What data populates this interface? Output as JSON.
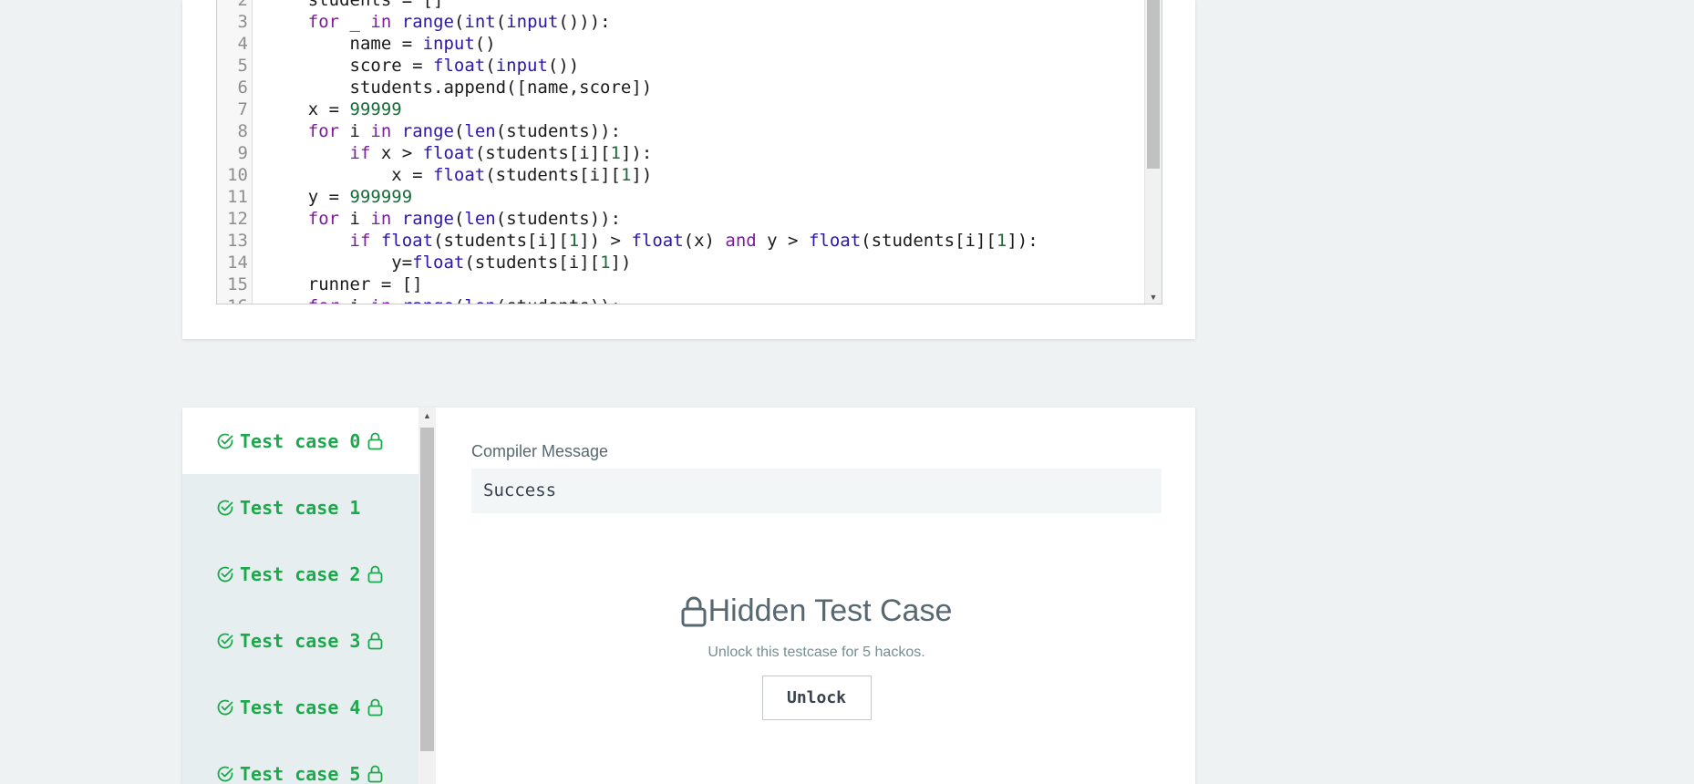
{
  "editor": {
    "lines": [
      {
        "num": "2",
        "tokens": [
          [
            "",
            "    students = []"
          ]
        ]
      },
      {
        "num": "3",
        "tokens": [
          [
            "",
            "    "
          ],
          [
            "kw",
            "for"
          ],
          [
            "",
            " _ "
          ],
          [
            "kw",
            "in"
          ],
          [
            "",
            " "
          ],
          [
            "bi",
            "range"
          ],
          [
            "",
            "("
          ],
          [
            "bi",
            "int"
          ],
          [
            "",
            "("
          ],
          [
            "bi",
            "input"
          ],
          [
            "",
            "())):"
          ]
        ]
      },
      {
        "num": "4",
        "tokens": [
          [
            "",
            "        name = "
          ],
          [
            "bi",
            "input"
          ],
          [
            "",
            "()"
          ]
        ]
      },
      {
        "num": "5",
        "tokens": [
          [
            "",
            "        score = "
          ],
          [
            "bi",
            "float"
          ],
          [
            "",
            "("
          ],
          [
            "bi",
            "input"
          ],
          [
            "",
            "())"
          ]
        ]
      },
      {
        "num": "6",
        "tokens": [
          [
            "",
            "        students.append([name,score])"
          ]
        ]
      },
      {
        "num": "7",
        "tokens": [
          [
            "",
            "    x = "
          ],
          [
            "num",
            "99999"
          ]
        ]
      },
      {
        "num": "8",
        "tokens": [
          [
            "",
            "    "
          ],
          [
            "kw",
            "for"
          ],
          [
            "",
            " i "
          ],
          [
            "kw",
            "in"
          ],
          [
            "",
            " "
          ],
          [
            "bi",
            "range"
          ],
          [
            "",
            "("
          ],
          [
            "bi",
            "len"
          ],
          [
            "",
            "(students)):"
          ]
        ]
      },
      {
        "num": "9",
        "tokens": [
          [
            "",
            "        "
          ],
          [
            "kw",
            "if"
          ],
          [
            "",
            " x > "
          ],
          [
            "bi",
            "float"
          ],
          [
            "",
            "(students[i]["
          ],
          [
            "num",
            "1"
          ],
          [
            "",
            "]):"
          ]
        ]
      },
      {
        "num": "10",
        "tokens": [
          [
            "",
            "            x = "
          ],
          [
            "bi",
            "float"
          ],
          [
            "",
            "(students[i]["
          ],
          [
            "num",
            "1"
          ],
          [
            "",
            "])"
          ]
        ]
      },
      {
        "num": "11",
        "tokens": [
          [
            "",
            "    y = "
          ],
          [
            "num",
            "999999"
          ]
        ]
      },
      {
        "num": "12",
        "tokens": [
          [
            "",
            "    "
          ],
          [
            "kw",
            "for"
          ],
          [
            "",
            " i "
          ],
          [
            "kw",
            "in"
          ],
          [
            "",
            " "
          ],
          [
            "bi",
            "range"
          ],
          [
            "",
            "("
          ],
          [
            "bi",
            "len"
          ],
          [
            "",
            "(students)):"
          ]
        ]
      },
      {
        "num": "13",
        "tokens": [
          [
            "",
            "        "
          ],
          [
            "kw",
            "if"
          ],
          [
            "",
            " "
          ],
          [
            "bi",
            "float"
          ],
          [
            "",
            "(students[i]["
          ],
          [
            "num",
            "1"
          ],
          [
            "",
            "]) > "
          ],
          [
            "bi",
            "float"
          ],
          [
            "",
            "(x) "
          ],
          [
            "kw",
            "and"
          ],
          [
            "",
            " y > "
          ],
          [
            "bi",
            "float"
          ],
          [
            "",
            "(students[i]["
          ],
          [
            "num",
            "1"
          ],
          [
            "",
            "]):"
          ]
        ]
      },
      {
        "num": "14",
        "tokens": [
          [
            "",
            "            y="
          ],
          [
            "bi",
            "float"
          ],
          [
            "",
            "(students[i]["
          ],
          [
            "num",
            "1"
          ],
          [
            "",
            "])"
          ]
        ]
      },
      {
        "num": "15",
        "tokens": [
          [
            "",
            "    runner = []"
          ]
        ]
      },
      {
        "num": "16",
        "tokens": [
          [
            "",
            "    "
          ],
          [
            "kw",
            "for"
          ],
          [
            "",
            " i "
          ],
          [
            "kw",
            "in"
          ],
          [
            "",
            " "
          ],
          [
            "bi",
            "range"
          ],
          [
            "",
            "("
          ],
          [
            "bi",
            "len"
          ],
          [
            "",
            "(students)):"
          ]
        ]
      }
    ],
    "scroll_arrow": "▼"
  },
  "tests": {
    "tabs": [
      {
        "label": "Test case 0",
        "locked": true,
        "active": true
      },
      {
        "label": "Test case 1",
        "locked": false,
        "active": false
      },
      {
        "label": "Test case 2",
        "locked": true,
        "active": false
      },
      {
        "label": "Test case 3",
        "locked": true,
        "active": false
      },
      {
        "label": "Test case 4",
        "locked": true,
        "active": false
      },
      {
        "label": "Test case 5",
        "locked": true,
        "active": false
      }
    ],
    "scroll_arrow": "▲",
    "compiler_label": "Compiler Message",
    "compiler_output": "Success",
    "hidden_title": "Hidden Test Case",
    "hidden_sub": "Unlock this testcase for 5 hackos.",
    "unlock_label": "Unlock"
  },
  "colors": {
    "success_green": "#1ba94c",
    "keyword": "#7a1e98",
    "builtin": "#2a17a8",
    "number": "#196b3a"
  },
  "icons": {
    "tab_status": "check-circle-icon",
    "tab_lock": "lock-icon",
    "hidden_lock": "lock-icon"
  }
}
